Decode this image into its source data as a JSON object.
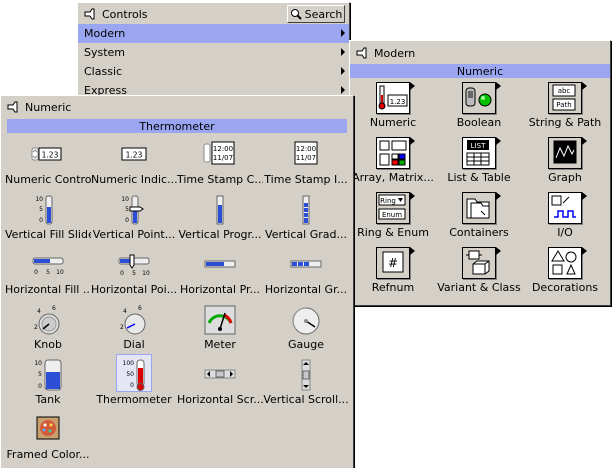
{
  "controls_window": {
    "title": "Controls",
    "search_label": "Search",
    "menu": [
      {
        "label": "Modern",
        "selected": true
      },
      {
        "label": "System",
        "selected": false
      },
      {
        "label": "Classic",
        "selected": false
      },
      {
        "label": "Express",
        "selected": false
      }
    ]
  },
  "modern_window": {
    "title": "Modern",
    "section": "Numeric",
    "items": [
      {
        "label": "Numeric",
        "icon": "thermometer-numeric-icon"
      },
      {
        "label": "Boolean",
        "icon": "boolean-switch-led-icon"
      },
      {
        "label": "String & Path",
        "icon": "string-path-icon"
      },
      {
        "label": "Array, Matrix...",
        "icon": "array-matrix-icon"
      },
      {
        "label": "List & Table",
        "icon": "list-table-icon"
      },
      {
        "label": "Graph",
        "icon": "graph-icon"
      },
      {
        "label": "Ring & Enum",
        "icon": "ring-enum-icon"
      },
      {
        "label": "Containers",
        "icon": "containers-icon"
      },
      {
        "label": "I/O",
        "icon": "io-icon"
      },
      {
        "label": "Refnum",
        "icon": "refnum-icon"
      },
      {
        "label": "Variant & Class",
        "icon": "variant-class-icon"
      },
      {
        "label": "Decorations",
        "icon": "decorations-icon"
      }
    ]
  },
  "numeric_window": {
    "title": "Numeric",
    "section": "Thermometer",
    "items": [
      {
        "label": "Numeric Control",
        "icon": "numeric-control-icon"
      },
      {
        "label": "Numeric Indic...",
        "icon": "numeric-indicator-icon"
      },
      {
        "label": "Time Stamp C...",
        "icon": "time-stamp-control-icon"
      },
      {
        "label": "Time Stamp I...",
        "icon": "time-stamp-indicator-icon"
      },
      {
        "label": "Vertical Fill Slide",
        "icon": "vertical-fill-slide-icon"
      },
      {
        "label": "Vertical Point...",
        "icon": "vertical-pointer-slide-icon"
      },
      {
        "label": "Vertical Progr...",
        "icon": "vertical-progress-bar-icon"
      },
      {
        "label": "Vertical Grad...",
        "icon": "vertical-graduated-bar-icon"
      },
      {
        "label": "Horizontal Fill ...",
        "icon": "horizontal-fill-slide-icon"
      },
      {
        "label": "Horizontal Poi...",
        "icon": "horizontal-pointer-slide-icon"
      },
      {
        "label": "Horizontal Pr...",
        "icon": "horizontal-progress-bar-icon"
      },
      {
        "label": "Horizontal Gr...",
        "icon": "horizontal-graduated-bar-icon"
      },
      {
        "label": "Knob",
        "icon": "knob-icon"
      },
      {
        "label": "Dial",
        "icon": "dial-icon"
      },
      {
        "label": "Meter",
        "icon": "meter-icon"
      },
      {
        "label": "Gauge",
        "icon": "gauge-icon"
      },
      {
        "label": "Tank",
        "icon": "tank-icon"
      },
      {
        "label": "Thermometer",
        "icon": "thermometer-icon",
        "selected": true
      },
      {
        "label": "Horizontal Scr...",
        "icon": "horizontal-scrollbar-icon"
      },
      {
        "label": "Vertical Scroll...",
        "icon": "vertical-scrollbar-icon"
      },
      {
        "label": "Framed Color...",
        "icon": "framed-color-box-icon"
      }
    ],
    "icon_text": {
      "numeric_value": "1.23",
      "time_line1": "12:00",
      "time_line2": "11/07",
      "scale_10": "10",
      "scale_5": "5",
      "scale_0": "0",
      "tank_100": "100",
      "tank_50": "50",
      "tank_0": "0",
      "knob_2": "2",
      "knob_4": "4",
      "knob_6": "6"
    }
  },
  "modern_icon_text": {
    "numeric_value": "1.23",
    "string_abc": "abc",
    "string_path": "Path",
    "list_label": "LIST",
    "ring_label": "Ring",
    "enum_label": "Enum",
    "refnum_hash": "#"
  }
}
